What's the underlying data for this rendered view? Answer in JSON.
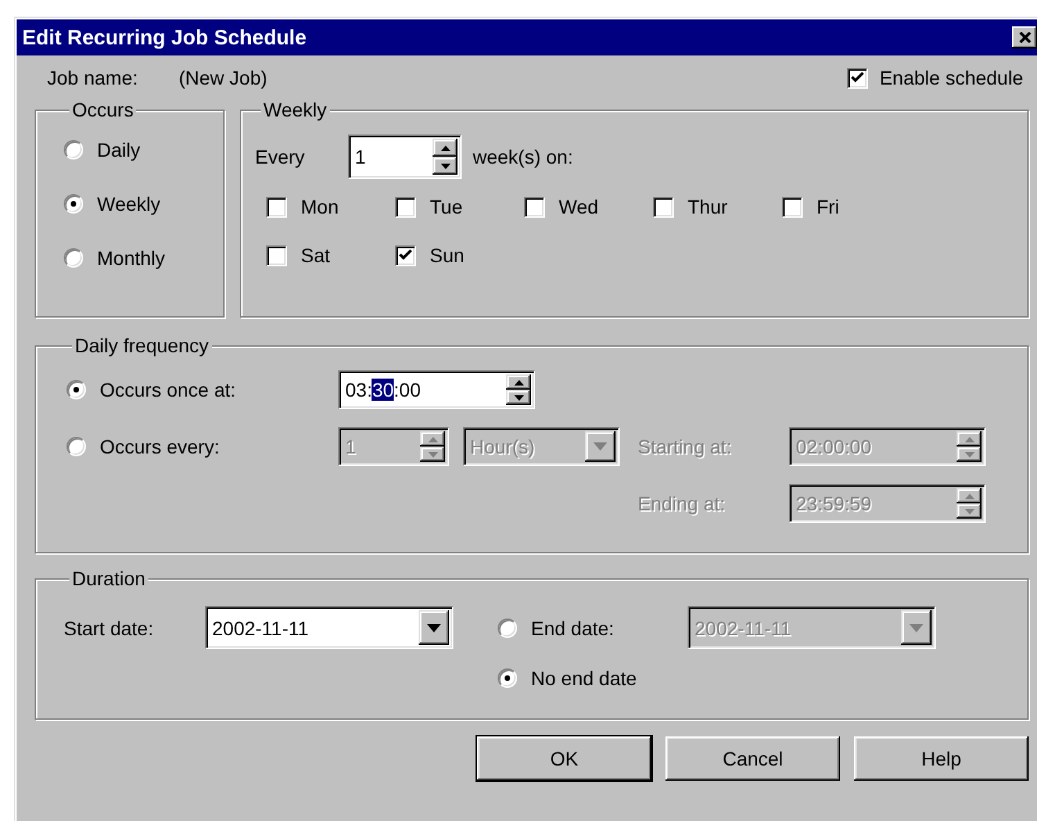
{
  "window": {
    "title": "Edit Recurring Job Schedule"
  },
  "job_name": {
    "label": "Job name:",
    "value": "(New Job)"
  },
  "enable_schedule": {
    "label": "Enable schedule",
    "checked": true
  },
  "occurs": {
    "title": "Occurs",
    "options": [
      {
        "label": "Daily",
        "selected": false
      },
      {
        "label": "Weekly",
        "selected": true
      },
      {
        "label": "Monthly",
        "selected": false
      }
    ]
  },
  "weekly": {
    "title": "Weekly",
    "every_label": "Every",
    "every_value": "1",
    "unit_label": "week(s) on:",
    "days": [
      {
        "label": "Mon",
        "checked": false
      },
      {
        "label": "Tue",
        "checked": false
      },
      {
        "label": "Wed",
        "checked": false
      },
      {
        "label": "Thur",
        "checked": false
      },
      {
        "label": "Fri",
        "checked": false
      },
      {
        "label": "Sat",
        "checked": false
      },
      {
        "label": "Sun",
        "checked": true
      }
    ]
  },
  "daily_frequency": {
    "title": "Daily frequency",
    "once": {
      "label": "Occurs once at:",
      "selected": true,
      "time": {
        "text_before": "03:",
        "text_selected": "30",
        "text_after": ":00",
        "disabled": false
      }
    },
    "every": {
      "label": "Occurs every:",
      "selected": false,
      "count": {
        "value": "1",
        "disabled": true
      },
      "unit": {
        "value": "Hour(s)",
        "disabled": true
      },
      "starting": {
        "label": "Starting at:",
        "value": "02:00:00",
        "disabled": true
      },
      "ending": {
        "label": "Ending at:",
        "value": "23:59:59",
        "disabled": true
      }
    }
  },
  "duration": {
    "title": "Duration",
    "start_date": {
      "label": "Start date:",
      "value": "2002-11-11",
      "disabled": false
    },
    "end_date": {
      "label": "End date:",
      "selected": false,
      "value": "2002-11-11",
      "disabled": true
    },
    "no_end_date": {
      "label": "No end date",
      "selected": true
    }
  },
  "buttons": [
    {
      "label": "OK",
      "default": true
    },
    {
      "label": "Cancel",
      "default": false
    },
    {
      "label": "Help",
      "default": false
    }
  ]
}
